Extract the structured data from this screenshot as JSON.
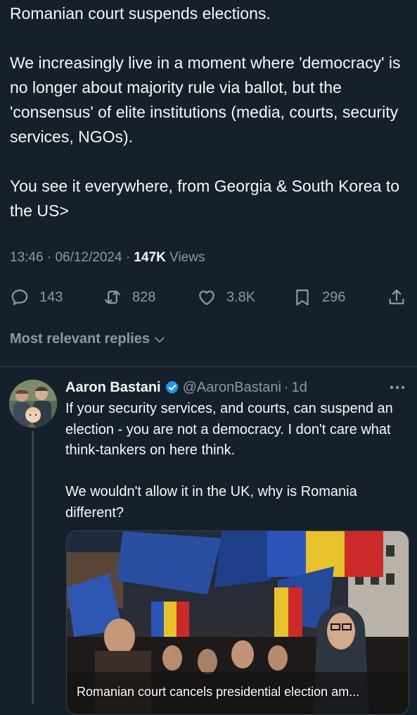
{
  "tweet": {
    "text": "Romanian court suspends elections.\n\nWe increasingly live in a moment where 'democracy' is no longer about majority rule via ballot, but the 'consensus' of elite institutions (media, courts, security services, NGOs).\n\nYou see it everywhere, from Georgia & South Korea to the US>",
    "time": "13:46",
    "date": "06/12/2024",
    "views_count": "147K",
    "views_label": "Views",
    "separator": "·"
  },
  "actions": {
    "replies": "143",
    "reposts": "828",
    "likes": "3.8K",
    "bookmarks": "296"
  },
  "replies_filter": {
    "label": "Most relevant replies"
  },
  "reply": {
    "name": "Aaron Bastani",
    "handle": "@AaronBastani",
    "separator": "·",
    "age": "1d",
    "text": "If your security services, and courts, can suspend an election - you are not a democracy. I don't care what think-tankers on here think.\n\nWe wouldn't allow it in the UK, why is Romania different?",
    "media_caption": "Romanian court cancels presidential election am..."
  },
  "icons": {
    "reply": "speech-bubble-icon",
    "repost": "repost-arrows-icon",
    "like": "heart-icon",
    "bookmark": "bookmark-icon",
    "share": "share-upload-icon",
    "verified": "verified-badge-icon",
    "more": "more-dots-icon",
    "chevron": "chevron-down-icon"
  },
  "colors": {
    "background": "#15202b",
    "text": "#f7f9f9",
    "muted": "#8b98a5",
    "divider": "#38444d",
    "verified": "#1d9bf0"
  }
}
